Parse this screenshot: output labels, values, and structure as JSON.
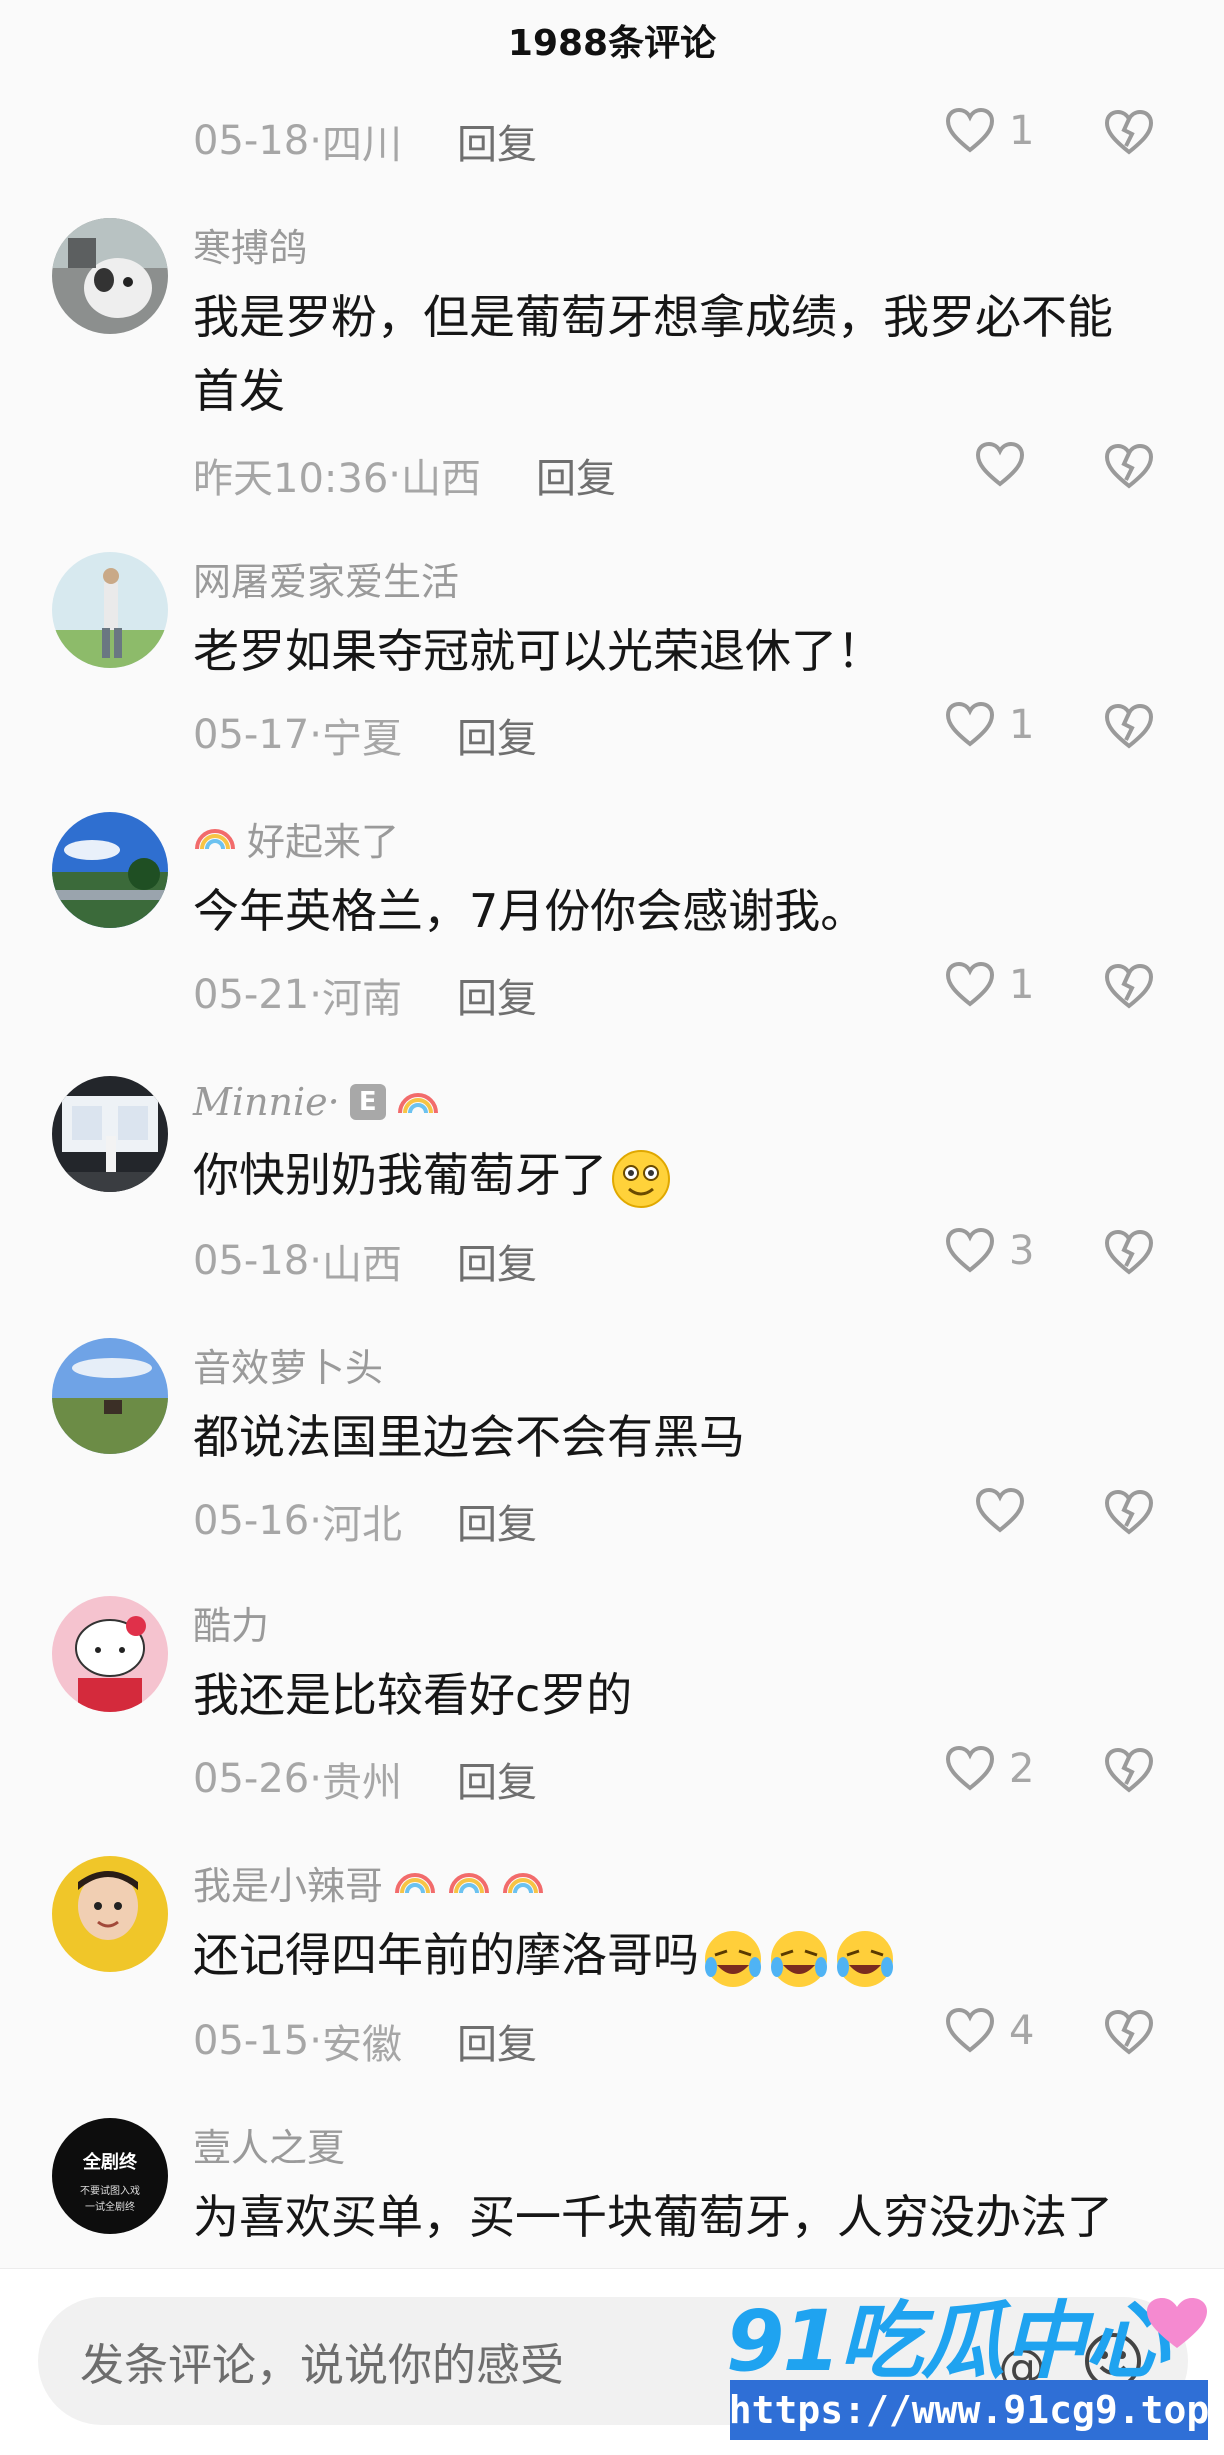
{
  "header": {
    "title": "1988条评论"
  },
  "reply_label": "回复",
  "top_meta": {
    "date": "05-18",
    "location": "四川",
    "likes": "1"
  },
  "comments": [
    {
      "name": "寒搏鸽",
      "text_lines": [
        "我是罗粉，但是葡萄牙想拿成绩，我罗必不能",
        "首发"
      ],
      "date": "昨天10:36",
      "location": "山西",
      "likes": ""
    },
    {
      "name": "网屠爱家爱生活",
      "text_lines": [
        "老罗如果夺冠就可以光荣退休了！"
      ],
      "date": "05-17",
      "location": "宁夏",
      "likes": "1"
    },
    {
      "name": "好起来了",
      "text_lines": [
        "今年英格兰，7月份你会感谢我。"
      ],
      "date": "05-21",
      "location": "河南",
      "likes": "1"
    },
    {
      "name": "Minnie·",
      "text_lines": [
        "你快别奶我葡萄牙了"
      ],
      "date": "05-18",
      "location": "山西",
      "likes": "3"
    },
    {
      "name": "音效萝卜头",
      "text_lines": [
        "都说法国里边会不会有黑马"
      ],
      "date": "05-16",
      "location": "河北",
      "likes": ""
    },
    {
      "name": "酷力",
      "text_lines": [
        "我还是比较看好c罗的"
      ],
      "date": "05-26",
      "location": "贵州",
      "likes": "2"
    },
    {
      "name": "我是小辣哥",
      "text_lines": [
        "还记得四年前的摩洛哥吗"
      ],
      "date": "05-15",
      "location": "安徽",
      "likes": "4"
    },
    {
      "name": "壹人之夏",
      "text_lines": [
        "为喜欢买单，买一千块葡萄牙，人穷没办法了"
      ],
      "date": "",
      "location": "",
      "likes": ""
    }
  ],
  "avatar8_text": [
    "全剧终",
    "不要试图入戏",
    "一试全剧终"
  ],
  "input": {
    "placeholder": "发条评论，说说你的感受"
  },
  "watermark": {
    "logo": "91吃瓜中心",
    "url": "https://www.91cg9.top"
  },
  "colors": {
    "meta_gray": "#a6a6a6",
    "reply_gray": "#6f6f6f",
    "input_bg": "#f1f1f1",
    "watermark_blue": "#1fa3f0"
  }
}
